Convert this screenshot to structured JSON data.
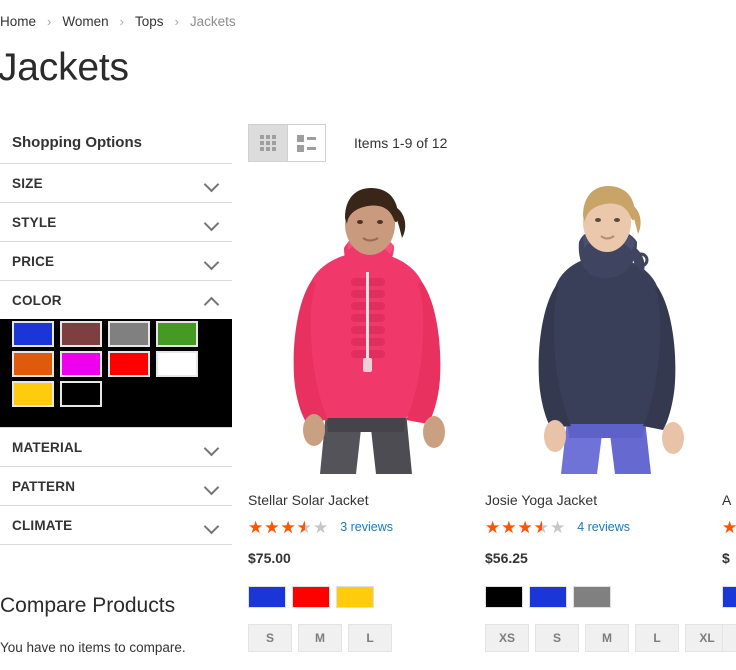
{
  "breadcrumb": {
    "items": [
      {
        "label": "Home",
        "current": false
      },
      {
        "label": "Women",
        "current": false
      },
      {
        "label": "Tops",
        "current": false
      },
      {
        "label": "Jackets",
        "current": true
      }
    ],
    "separator": "›"
  },
  "page_title": "Jackets",
  "sidebar": {
    "title": "Shopping Options",
    "filters": [
      {
        "name": "SIZE",
        "expanded": false
      },
      {
        "name": "STYLE",
        "expanded": false
      },
      {
        "name": "PRICE",
        "expanded": false
      },
      {
        "name": "COLOR",
        "expanded": true
      },
      {
        "name": "MATERIAL",
        "expanded": false
      },
      {
        "name": "PATTERN",
        "expanded": false
      },
      {
        "name": "CLIMATE",
        "expanded": false
      }
    ],
    "color_swatches": [
      {
        "name": "Black",
        "hex": "#000000"
      },
      {
        "name": "Blue",
        "hex": "#1a36d8"
      },
      {
        "name": "Brown",
        "hex": "#7d3f3f"
      },
      {
        "name": "Gray",
        "hex": "#808080"
      },
      {
        "name": "Green",
        "hex": "#449a22"
      },
      {
        "name": "Orange",
        "hex": "#e05a0c"
      },
      {
        "name": "Purple",
        "hex": "#ee00ee"
      },
      {
        "name": "Red",
        "hex": "#fe0000"
      },
      {
        "name": "White",
        "hex": "#ffffff"
      },
      {
        "name": "Yellow",
        "hex": "#ffcc0d"
      }
    ],
    "compare": {
      "title": "Compare Products",
      "empty_text": "You have no items to compare."
    }
  },
  "toolbar": {
    "modes": [
      {
        "name": "Grid",
        "icon": "grid-icon",
        "active": true
      },
      {
        "name": "List",
        "icon": "list-icon",
        "active": false
      }
    ],
    "amount": "Items 1-9 of 12"
  },
  "products": [
    {
      "name": "Stellar Solar Jacket",
      "rating_percent": 70,
      "reviews": "3 reviews",
      "price": "$75.00",
      "swatches": [
        {
          "name": "Blue",
          "hex": "#1a36d8"
        },
        {
          "name": "Red",
          "hex": "#fe0000"
        },
        {
          "name": "Yellow",
          "hex": "#ffcc0d"
        }
      ],
      "sizes": [
        "S",
        "M",
        "L"
      ],
      "photo": "model-pink-ruffle-jacket"
    },
    {
      "name": "Josie Yoga Jacket",
      "rating_percent": 70,
      "reviews": "4 reviews",
      "price": "$56.25",
      "swatches": [
        {
          "name": "Black",
          "hex": "#000000"
        },
        {
          "name": "Blue",
          "hex": "#1a36d8"
        },
        {
          "name": "Gray",
          "hex": "#808080"
        }
      ],
      "sizes": [
        "XS",
        "S",
        "M",
        "L",
        "XL"
      ],
      "photo": "model-navy-cowl-jacket"
    },
    {
      "name": "A",
      "rating_percent": 70,
      "reviews": "",
      "price": "$",
      "swatches": [
        {
          "name": "Blue",
          "hex": "#1a36d8"
        }
      ],
      "sizes": [
        ""
      ],
      "photo": "model-cut-off"
    }
  ],
  "stars_glyph": "★★★★★"
}
